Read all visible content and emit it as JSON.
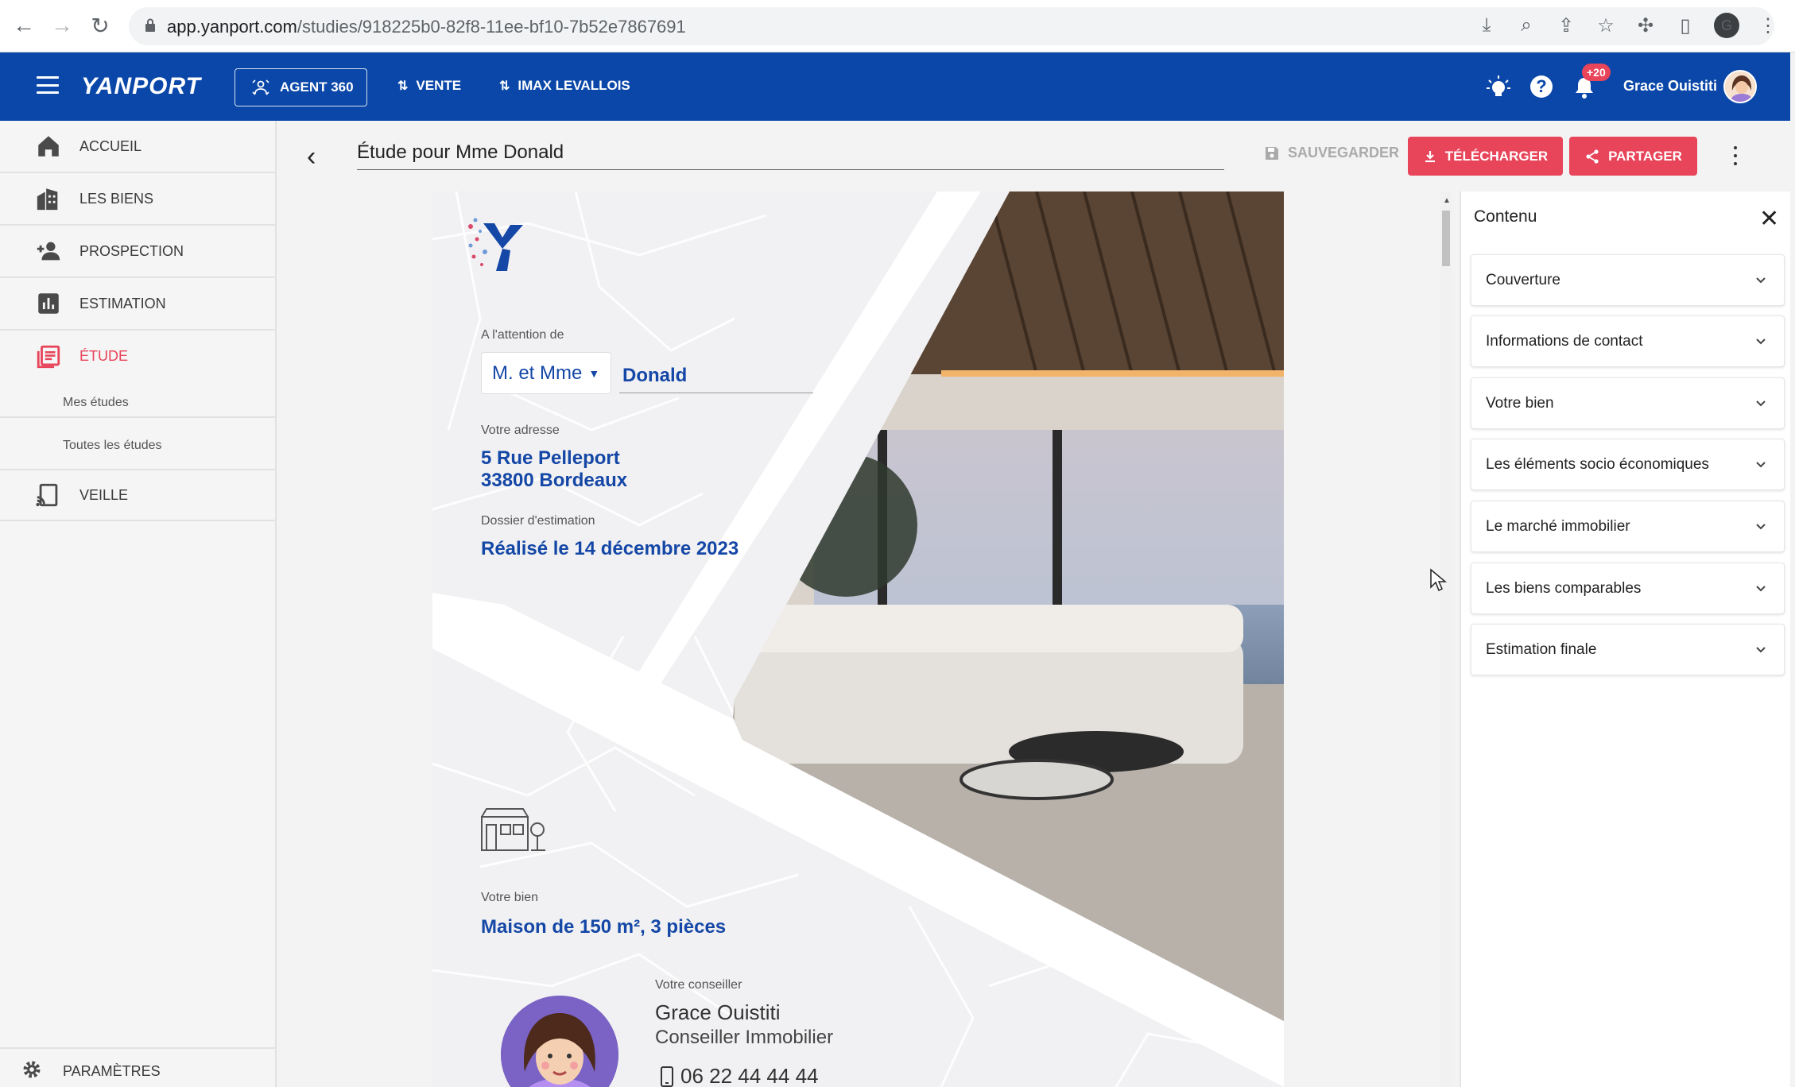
{
  "browser": {
    "url_host": "app.yanport.com",
    "url_path": "/studies/918225b0-82f8-11ee-bf10-7b52e7867691",
    "profile_letter": "G"
  },
  "header": {
    "logo": "YANPORT",
    "agent_button": "AGENT 360",
    "nav": [
      {
        "label": "VENTE",
        "icon": "swap-vertical-icon"
      },
      {
        "label": "IMAX LEVALLOIS",
        "icon": "swap-vertical-icon"
      }
    ],
    "notification_count": "+20",
    "user_name": "Grace Ouistiti"
  },
  "sidebar": {
    "items": [
      {
        "label": "ACCUEIL",
        "icon": "home-icon"
      },
      {
        "label": "LES BIENS",
        "icon": "buildings-icon"
      },
      {
        "label": "PROSPECTION",
        "icon": "add-person-icon"
      },
      {
        "label": "ESTIMATION",
        "icon": "bar-chart-icon"
      },
      {
        "label": "ÉTUDE",
        "icon": "document-list-icon",
        "active": true
      },
      {
        "label": "VEILLE",
        "icon": "cast-icon"
      }
    ],
    "sub_items": [
      "Mes études",
      "Toutes les études"
    ],
    "settings": "PARAMÈTRES",
    "active_color": "#e8445a"
  },
  "toolbar": {
    "title": "Étude pour Mme Donald",
    "save": "SAUVEGARDER",
    "download": "TÉLÉCHARGER",
    "share": "PARTAGER"
  },
  "document": {
    "attention_label": "A l'attention de",
    "salutation": "M. et Mme",
    "client_name": "Donald",
    "address_label": "Votre adresse",
    "address_line1": "5 Rue Pelleport",
    "address_line2": "33800 Bordeaux",
    "dossier_label": "Dossier d'estimation",
    "dossier_value": "Réalisé le 14 décembre 2023",
    "bien_label": "Votre bien",
    "bien_value": "Maison de 150 m², 3 pièces",
    "advisor_label": "Votre conseiller",
    "advisor_name": "Grace Ouistiti",
    "advisor_role": "Conseiller Immobilier",
    "advisor_phone": "06 22 44 44 44",
    "accent_color": "#1447a6"
  },
  "panel": {
    "title": "Contenu",
    "sections": [
      "Couverture",
      "Informations de contact",
      "Votre bien",
      "Les éléments socio économiques",
      "Le marché immobilier",
      "Les biens comparables",
      "Estimation finale"
    ]
  },
  "colors": {
    "brand_blue": "#0a47a9",
    "button_pink": "#e8445a"
  }
}
